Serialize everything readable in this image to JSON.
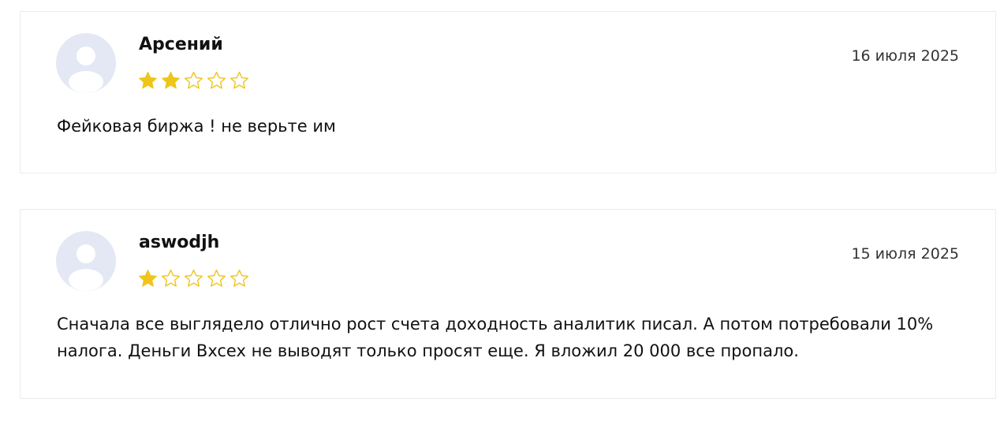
{
  "colors": {
    "star_filled": "#efc51a",
    "star_empty_outline": "#efc51a",
    "avatar_bg": "#e3e8f4",
    "avatar_figure": "#ffffff",
    "card_border": "#ececec"
  },
  "reviews": [
    {
      "author": "Арсений",
      "rating": 2,
      "max_rating": 5,
      "date": "16 июля 2025",
      "text": "Фейковая биржа ! не верьте им",
      "avatar_icon": "user-silhouette-icon"
    },
    {
      "author": "aswodjh",
      "rating": 1,
      "max_rating": 5,
      "date": "15 июля 2025",
      "text": "Сначала все выглядело отлично рост счета доходность аналитик писал. А потом потребовали 10% налога. Деньги Bxcex не выводят только просят еще. Я вложил 20 000 все пропало.",
      "avatar_icon": "user-silhouette-icon"
    }
  ]
}
